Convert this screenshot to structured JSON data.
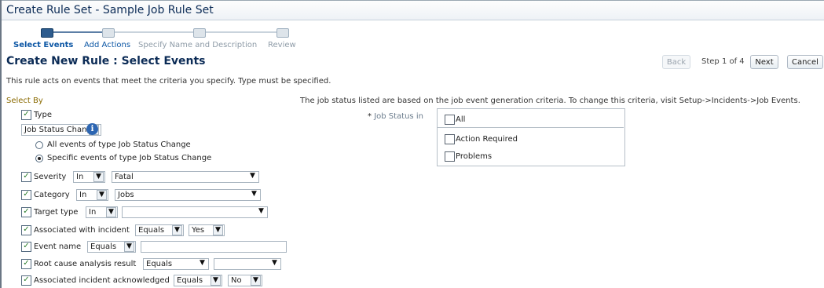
{
  "page": {
    "title": "Create Rule Set - Sample Job Rule Set"
  },
  "train": {
    "steps": [
      {
        "label": "Select Events"
      },
      {
        "label": "Add Actions"
      },
      {
        "label": "Specify Name and Description"
      },
      {
        "label": "Review"
      }
    ]
  },
  "header": {
    "title": "Create New Rule : Select Events",
    "back_label": "Back",
    "step_text": "Step 1 of 4",
    "next_label": "Next",
    "cancel_label": "Cancel"
  },
  "instructions": "This rule acts on events that meet the criteria you specify. Type must be specified.",
  "select_by_label": "Select By",
  "job_status": {
    "info": "The job status listed are based on the job event generation criteria. To change this criteria, visit Setup->Incidents->Job Events.",
    "required_mark": "*",
    "label": "Job Status in",
    "options": [
      {
        "label": "All",
        "checked": false
      },
      {
        "label": "Action Required",
        "checked": false
      },
      {
        "label": "Problems",
        "checked": false
      }
    ]
  },
  "criteria": {
    "type": {
      "label": "Type",
      "checked": true,
      "value": "Job Status Change",
      "radio_all": "All events of type Job Status Change",
      "radio_specific": "Specific events of type Job Status Change",
      "selected_radio": "specific"
    },
    "severity": {
      "label": "Severity",
      "op": "In",
      "value": "Fatal",
      "checked": true
    },
    "category": {
      "label": "Category",
      "op": "In",
      "value": "Jobs",
      "checked": true
    },
    "target_type": {
      "label": "Target type",
      "op": "In",
      "value": "",
      "checked": true
    },
    "associated_incident": {
      "label": "Associated with incident",
      "op": "Equals",
      "value": "Yes",
      "checked": true
    },
    "event_name": {
      "label": "Event name",
      "op": "Equals",
      "value": "",
      "checked": true
    },
    "root_cause": {
      "label": "Root cause analysis result",
      "op": "Equals",
      "value": "",
      "checked": true
    },
    "incident_ack": {
      "label": "Associated incident acknowledged",
      "op": "Equals",
      "value": "No",
      "checked": true
    }
  },
  "icons": {
    "dropdown": "chevron-down-icon",
    "info": "info-icon",
    "check": "checkmark-icon"
  },
  "colors": {
    "accent": "#2d5b8d",
    "link": "#0d57a5",
    "title": "#0b2b56"
  }
}
